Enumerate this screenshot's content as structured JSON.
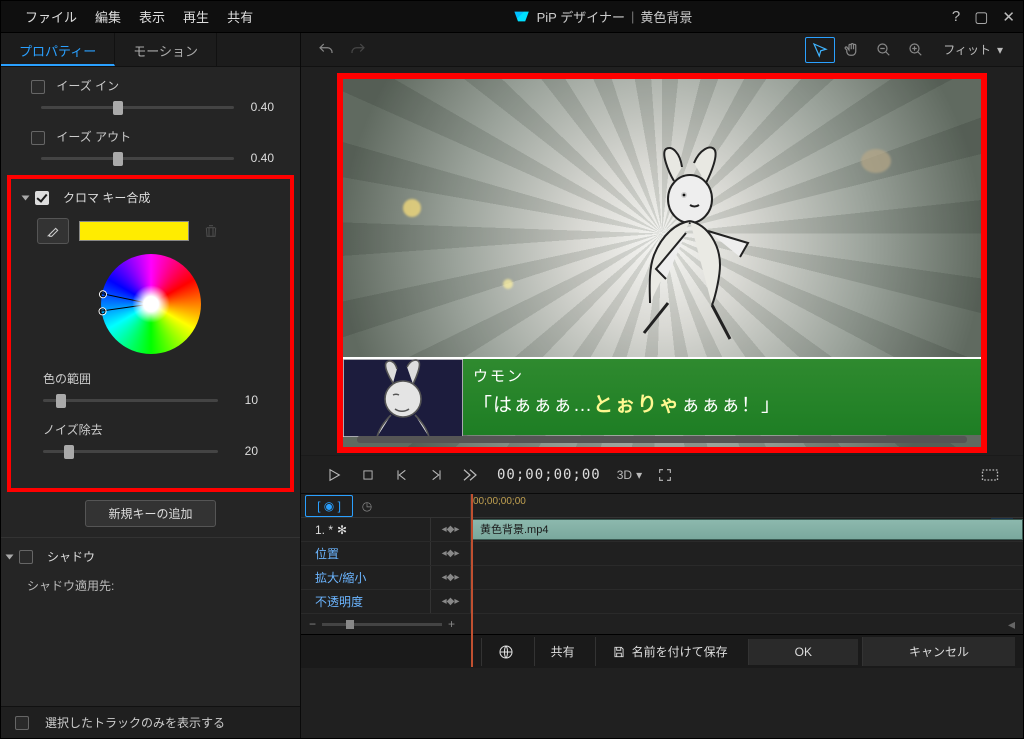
{
  "title": {
    "app": "PiP デザイナー",
    "sep": "|",
    "doc": "黄色背景"
  },
  "menu": [
    "ファイル",
    "編集",
    "表示",
    "再生",
    "共有"
  ],
  "tabs": {
    "properties": "プロパティー",
    "motion": "モーション"
  },
  "ease": {
    "in_label": "イーズ イン",
    "in_val": "0.40",
    "out_label": "イーズ アウト",
    "out_val": "0.40"
  },
  "chroma": {
    "title": "クロマ キー合成",
    "swatch_color": "#ffec00",
    "range_label": "色の範囲",
    "range_val": "10",
    "denoise_label": "ノイズ除去",
    "denoise_val": "20",
    "new_key_btn": "新規キーの追加"
  },
  "shadow": {
    "title": "シャドウ",
    "apply_label": "シャドウ適用先:"
  },
  "left_footer": "選択したトラックのみを表示する",
  "toolbar": {
    "fit": "フィット"
  },
  "caption": {
    "name": "ウモン",
    "line_pre": "「はぁぁぁ…",
    "line_em": "とぉりゃ",
    "line_post": "ぁぁぁ！」"
  },
  "play": {
    "timecode": "00;00;00;00",
    "dim": "3D"
  },
  "timeline": {
    "ruler_tc": "00;00;00;00",
    "track1_label": "1. *",
    "clip_name": "黄色背景.mp4",
    "rows": [
      "位置",
      "拡大/縮小",
      "不透明度"
    ]
  },
  "footer": {
    "share": "共有",
    "saveas": "名前を付けて保存",
    "ok": "OK",
    "cancel": "キャンセル"
  }
}
